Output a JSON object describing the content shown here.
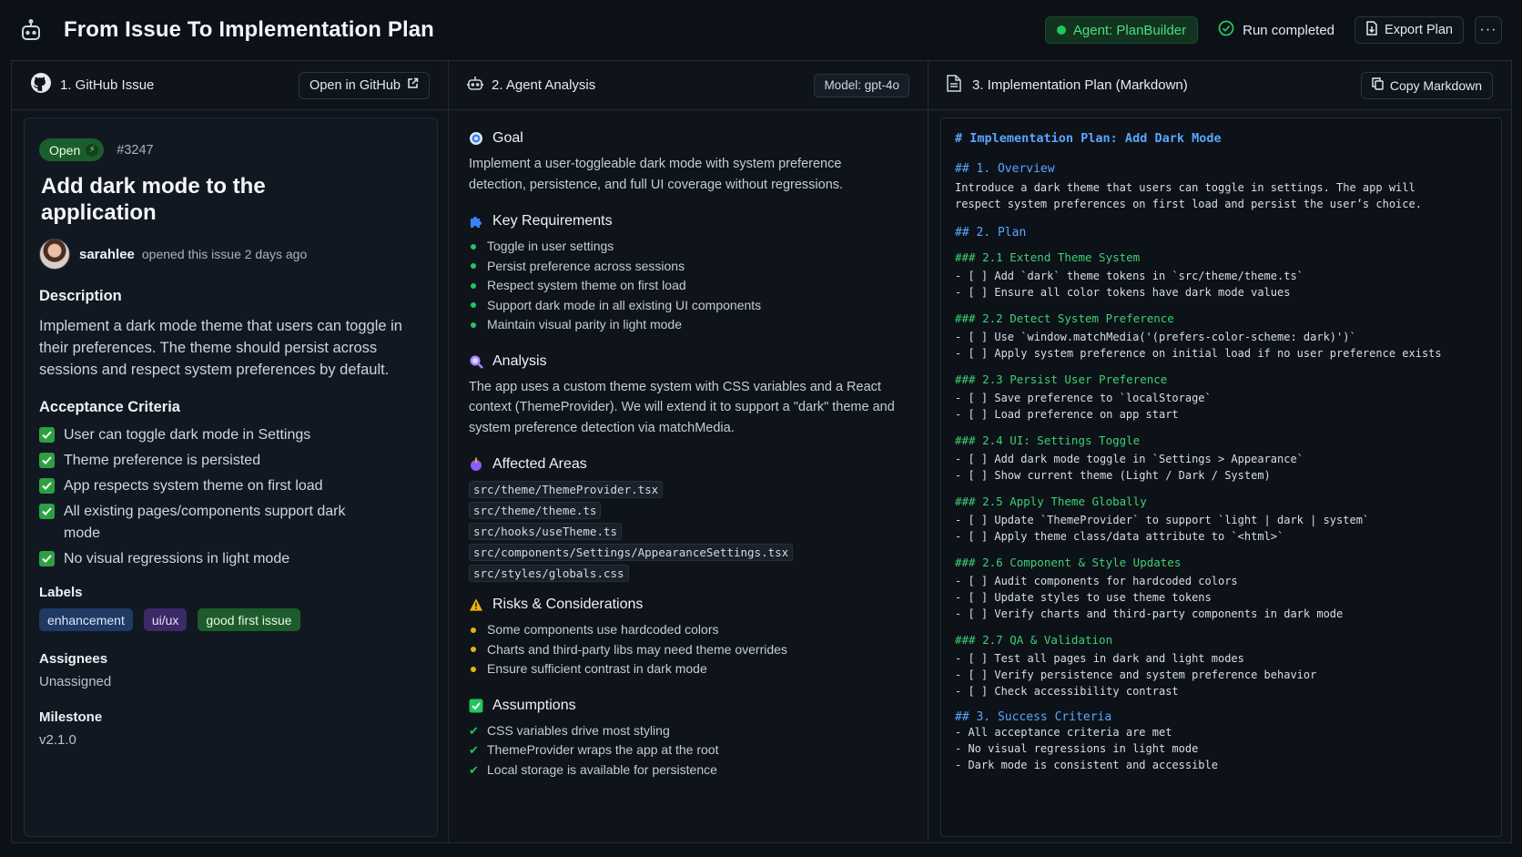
{
  "app": {
    "title": "From Issue To Implementation Plan",
    "agent_label": "Agent: PlanBuilder",
    "run_status": "Run completed",
    "export_label": "Export Plan",
    "more_label": "···"
  },
  "issue_panel": {
    "header": "1. GitHub Issue",
    "open_github_label": "Open in GitHub",
    "status": "Open",
    "number": "#3247",
    "title": "Add dark mode to the application",
    "author": "sarahlee",
    "author_meta": "opened this issue 2 days ago",
    "description_heading": "Description",
    "description": "Implement a dark mode theme that users can toggle in their preferences. The theme should persist across sessions and respect system preferences by default.",
    "criteria_heading": "Acceptance Criteria",
    "criteria": [
      "User can toggle dark mode in Settings",
      "Theme preference is persisted",
      "App respects system theme on first load",
      "All existing pages/components support dark mode",
      "No visual regressions in light mode"
    ],
    "labels_heading": "Labels",
    "labels": [
      "enhancement",
      "ui/ux",
      "good first issue"
    ],
    "assignees_heading": "Assignees",
    "assignees": "Unassigned",
    "milestone_heading": "Milestone",
    "milestone": "v2.1.0"
  },
  "analysis_panel": {
    "header": "2. Agent Analysis",
    "model": "Model: gpt-4o",
    "goal_heading": "Goal",
    "goal": "Implement a user-toggleable dark mode with system preference detection, persistence, and full UI coverage without regressions.",
    "requirements_heading": "Key Requirements",
    "requirements": [
      "Toggle in user settings",
      "Persist preference across sessions",
      "Respect system theme on first load",
      "Support dark mode in all existing UI components",
      "Maintain visual parity in light mode"
    ],
    "analysis_heading": "Analysis",
    "analysis": "The app uses a custom theme system with CSS variables and a React context (ThemeProvider). We will extend it to support a \"dark\" theme and system preference detection via matchMedia.",
    "affected_heading": "Affected Areas",
    "affected": [
      "src/theme/ThemeProvider.tsx",
      "src/theme/theme.ts",
      "src/hooks/useTheme.ts",
      "src/components/Settings/AppearanceSettings.tsx",
      "src/styles/globals.css"
    ],
    "risks_heading": "Risks & Considerations",
    "risks": [
      "Some components use hardcoded colors",
      "Charts and third-party libs may need theme overrides",
      "Ensure sufficient contrast in dark mode"
    ],
    "assumptions_heading": "Assumptions",
    "assumptions": [
      "CSS variables drive most styling",
      "ThemeProvider wraps the app at the root",
      "Local storage is available for persistence"
    ]
  },
  "plan_panel": {
    "header": "3. Implementation Plan (Markdown)",
    "copy_label": "Copy Markdown",
    "h1": "# Implementation Plan: Add Dark Mode",
    "overview_h": "## 1. Overview",
    "overview_1": "Introduce a dark theme that users can toggle in settings. The app will",
    "overview_2": "respect system preferences on first load and persist the user’s choice.",
    "plan_h": "## 2. Plan",
    "s21_h": "### 2.1 Extend Theme System",
    "s21_1": "- [ ] Add `dark` theme tokens in `src/theme/theme.ts`",
    "s21_2": "- [ ] Ensure all color tokens have dark mode values",
    "s22_h": "### 2.2 Detect System Preference",
    "s22_1": "- [ ] Use `window.matchMedia('(prefers-color-scheme: dark)')`",
    "s22_2": "- [ ] Apply system preference on initial load if no user preference exists",
    "s23_h": "### 2.3 Persist User Preference",
    "s23_1": "- [ ] Save preference to `localStorage`",
    "s23_2": "- [ ] Load preference on app start",
    "s24_h": "### 2.4 UI: Settings Toggle",
    "s24_1": "- [ ] Add dark mode toggle in `Settings > Appearance`",
    "s24_2": "- [ ] Show current theme (Light / Dark / System)",
    "s25_h": "### 2.5 Apply Theme Globally",
    "s25_1": "- [ ] Update `ThemeProvider` to support `light | dark | system`",
    "s25_2": "- [ ] Apply theme class/data attribute to `<html>`",
    "s26_h": "### 2.6 Component & Style Updates",
    "s26_1": "- [ ] Audit components for hardcoded colors",
    "s26_2": "- [ ] Update styles to use theme tokens",
    "s26_3": "- [ ] Verify charts and third-party components in dark mode",
    "s27_h": "### 2.7 QA & Validation",
    "s27_1": "- [ ] Test all pages in dark and light modes",
    "s27_2": "- [ ] Verify persistence and system preference behavior",
    "s27_3": "- [ ] Check accessibility contrast",
    "s3_h": "## 3. Success Criteria",
    "s3_1": "- All acceptance criteria are met",
    "s3_2": "- No visual regressions in light mode",
    "s3_3": "- Dark mode is consistent and accessible"
  },
  "colors": {
    "background": "#0c1118",
    "accent_green": "#22c55e",
    "md_heading_blue": "#5aa5ff",
    "md_heading_green": "#3fcf71",
    "warning": "#eab308"
  },
  "icons": [
    "robot-icon",
    "github-icon",
    "external-link-icon",
    "check-circle-icon",
    "export-icon",
    "document-icon",
    "copy-icon",
    "target-icon",
    "puzzle-icon",
    "magnifier-icon",
    "pin-icon",
    "warning-icon",
    "checkbox-icon"
  ]
}
